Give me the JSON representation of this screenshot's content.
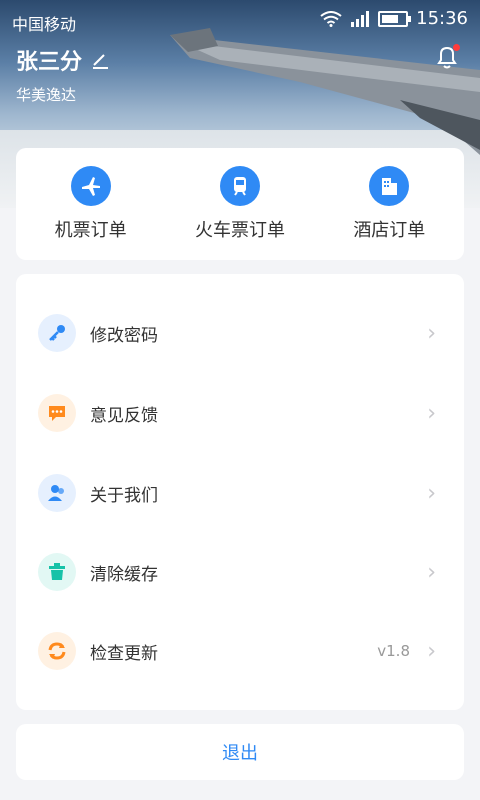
{
  "status": {
    "carrier": "中国移动",
    "time": "15:36"
  },
  "profile": {
    "name": "张三分",
    "company": "华美逸达"
  },
  "orders": [
    {
      "label": "机票订单",
      "icon": "plane-icon"
    },
    {
      "label": "火车票订单",
      "icon": "train-icon"
    },
    {
      "label": "酒店订单",
      "icon": "hotel-icon"
    }
  ],
  "menu": [
    {
      "label": "修改密码",
      "icon": "key-icon",
      "color": "#2f8af5",
      "bg": "#e6f0fe"
    },
    {
      "label": "意见反馈",
      "icon": "chat-icon",
      "color": "#ff8a1d",
      "bg": "#fff1e2"
    },
    {
      "label": "关于我们",
      "icon": "users-icon",
      "color": "#2f8af5",
      "bg": "#e6f0fe"
    },
    {
      "label": "清除缓存",
      "icon": "trash-icon",
      "color": "#16c2a8",
      "bg": "#e2f8f4"
    },
    {
      "label": "检查更新",
      "icon": "refresh-icon",
      "color": "#ff8a1d",
      "bg": "#fff1e2",
      "version": "v1.8"
    }
  ],
  "logout": "退出"
}
